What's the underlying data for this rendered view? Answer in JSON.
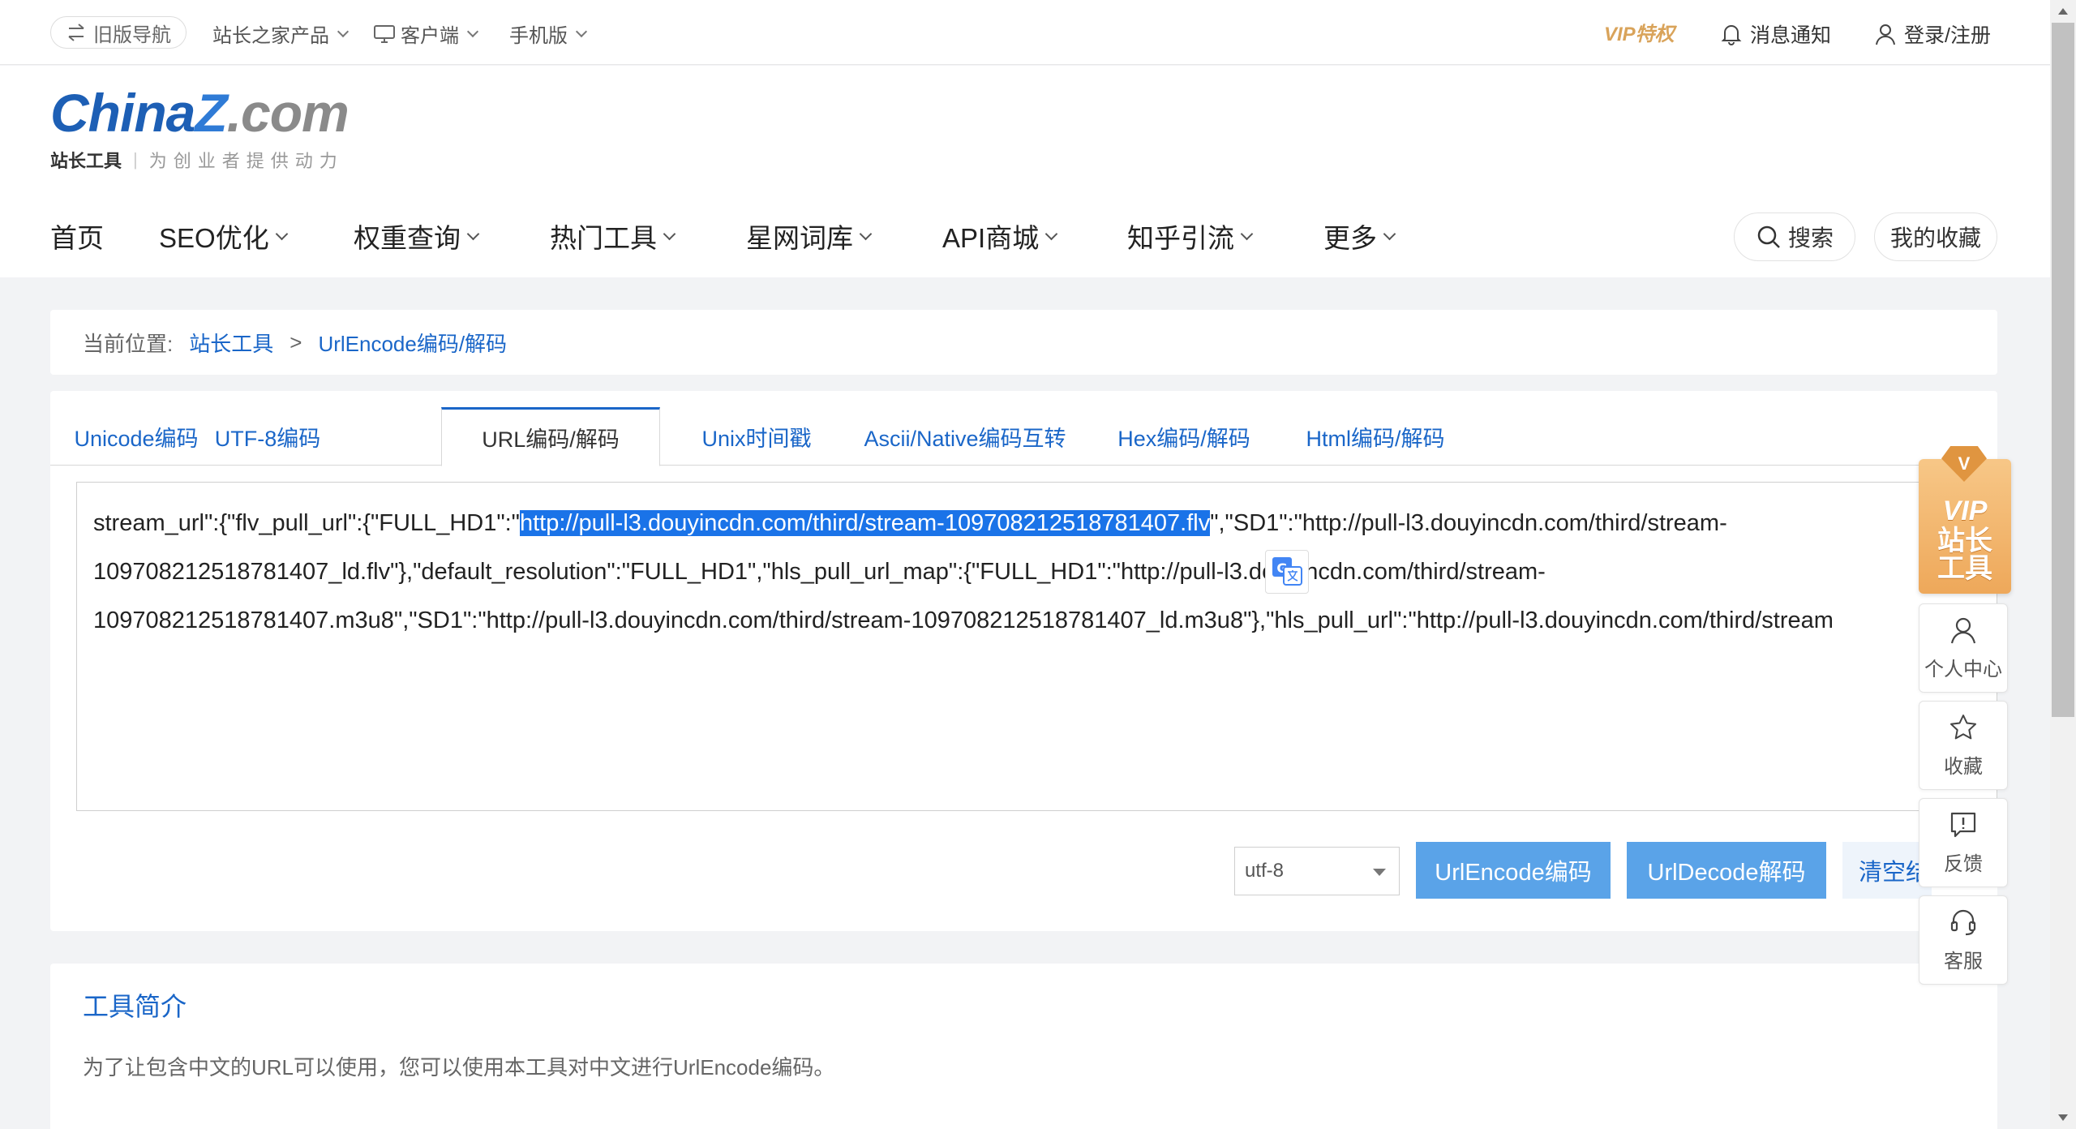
{
  "topbar": {
    "old_nav": "旧版导航",
    "products": "站长之家产品",
    "client": "客户端",
    "mobile": "手机版",
    "vip": "VIP特权",
    "notify": "消息通知",
    "login": "登录/注册"
  },
  "logo": {
    "part1": "China",
    "part2": "Z",
    "part3": ".com",
    "sub1": "站长工具",
    "sub2": "为创业者提供动力"
  },
  "nav": {
    "items": [
      {
        "label": "首页",
        "dropdown": false
      },
      {
        "label": "SEO优化",
        "dropdown": true
      },
      {
        "label": "权重查询",
        "dropdown": true
      },
      {
        "label": "热门工具",
        "dropdown": true
      },
      {
        "label": "星网词库",
        "dropdown": true
      },
      {
        "label": "API商城",
        "dropdown": true
      },
      {
        "label": "知乎引流",
        "dropdown": true
      },
      {
        "label": "更多",
        "dropdown": true
      }
    ],
    "search": "搜索",
    "favorites": "我的收藏"
  },
  "breadcrumb": {
    "label": "当前位置:",
    "home": "站长工具",
    "sep": ">",
    "current": "UrlEncode编码/解码"
  },
  "tabs": [
    {
      "label": "Unicode编码",
      "active": false
    },
    {
      "label": "UTF-8编码",
      "active": false
    },
    {
      "label": "URL编码/解码",
      "active": true
    },
    {
      "label": "Unix时间戳",
      "active": false
    },
    {
      "label": "Ascii/Native编码互转",
      "active": false
    },
    {
      "label": "Hex编码/解码",
      "active": false
    },
    {
      "label": "Html编码/解码",
      "active": false
    }
  ],
  "input": {
    "pre": "stream_url\":{\"flv_pull_url\":{\"FULL_HD1\":\"",
    "selected": "http://pull-l3.douyincdn.com/third/stream-109708212518781407.flv",
    "line1_rest": "\",\"SD1\":\"http://pull-l3.douyincdn.com/third/stream-",
    "line2": "109708212518781407_ld.flv\"},\"default_resolution\":\"FULL_HD1\",\"hls_pull_url_map\":{\"FULL_HD1\":\"http://pull-l3.douyincdn.com/third/stream-",
    "line3": "109708212518781407.m3u8\",\"SD1\":\"http://pull-l3.douyincdn.com/third/stream-109708212518781407_ld.m3u8\"},\"hls_pull_url\":\"http://pull-l3.douyincdn.com/third/stream"
  },
  "controls": {
    "charset": "utf-8",
    "encode": "UrlEncode编码",
    "decode": "UrlDecode解码",
    "clear": "清空结果"
  },
  "intro": {
    "title": "工具简介",
    "text": "为了让包含中文的URL可以使用，您可以使用本工具对中文进行UrlEncode编码。"
  },
  "sidebar": {
    "vip_gem": "V",
    "vip_t1": "VIP",
    "vip_t2": "站长工具",
    "items": [
      {
        "label": "个人中心",
        "icon": "user-icon"
      },
      {
        "label": "收藏",
        "icon": "star-icon"
      },
      {
        "label": "反馈",
        "icon": "feedback-icon"
      },
      {
        "label": "客服",
        "icon": "headset-icon"
      }
    ]
  },
  "colors": {
    "accent": "#1a66c8",
    "button": "#5aa3e8",
    "selection": "#1a73e8",
    "vip": "#eea85a"
  }
}
